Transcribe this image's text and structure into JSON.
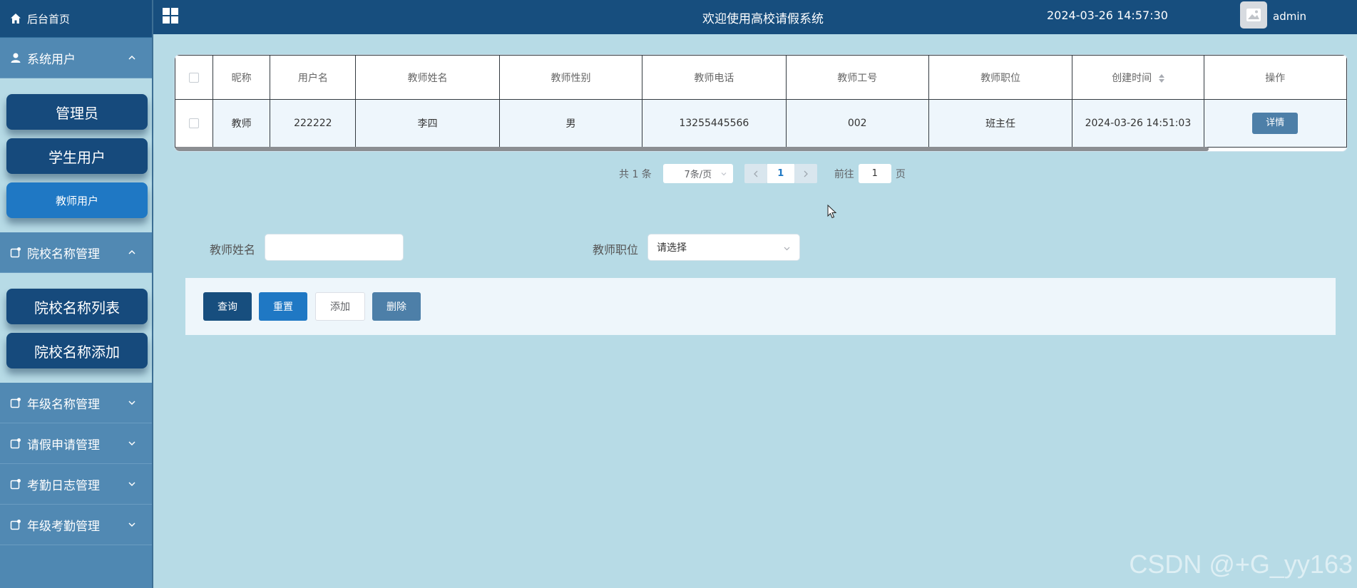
{
  "sidebar": {
    "home_label": "后台首页",
    "groups": [
      {
        "label": "系统用户",
        "expanded": true,
        "items": [
          "管理员",
          "学生用户",
          "教师用户"
        ],
        "active_index": 2
      },
      {
        "label": "院校名称管理",
        "expanded": true,
        "items": [
          "院校名称列表",
          "院校名称添加"
        ]
      },
      {
        "label": "年级名称管理",
        "expanded": false
      },
      {
        "label": "请假申请管理",
        "expanded": false
      },
      {
        "label": "考勤日志管理",
        "expanded": false
      },
      {
        "label": "年级考勤管理",
        "expanded": false
      }
    ]
  },
  "header": {
    "title": "欢迎使用高校请假系统",
    "datetime": "2024-03-26 14:57:30",
    "username": "admin"
  },
  "table": {
    "columns": [
      "昵称",
      "用户名",
      "教师姓名",
      "教师性别",
      "教师电话",
      "教师工号",
      "教师职位",
      "创建时间",
      "操作"
    ],
    "rows": [
      {
        "nickname": "教师",
        "username": "222222",
        "name": "李四",
        "gender": "男",
        "phone": "13255445566",
        "job_no": "002",
        "position": "班主任",
        "created": "2024-03-26 14:51:03",
        "action": "详情"
      }
    ]
  },
  "pagination": {
    "total": "共 1 条",
    "page_size": "7条/页",
    "current_page": "1",
    "goto_label": "前往",
    "goto_value": "1",
    "page_suffix": "页"
  },
  "search": {
    "name_label": "教师姓名",
    "name_value": "",
    "position_label": "教师职位",
    "position_placeholder": "请选择"
  },
  "actions": {
    "query": "查询",
    "reset": "重置",
    "add": "添加",
    "delete": "删除"
  },
  "watermark": "CSDN @+G_yy163",
  "colors": {
    "sidebar_bg": "#4f88b2",
    "header_bg": "#174e7e",
    "content_bg": "#b7dbe6",
    "active_item": "#1f78c4"
  }
}
